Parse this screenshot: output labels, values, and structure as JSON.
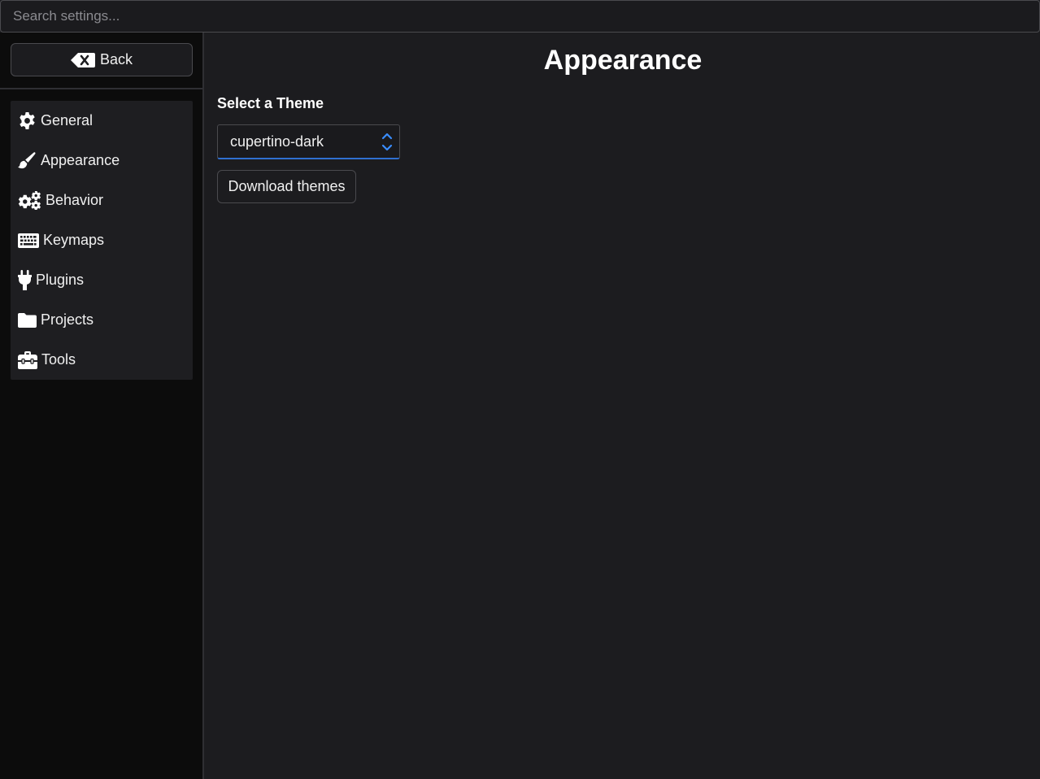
{
  "search": {
    "placeholder": "Search settings..."
  },
  "sidebar": {
    "back_label": "Back",
    "items": [
      {
        "label": "General",
        "icon": "gear-icon"
      },
      {
        "label": "Appearance",
        "icon": "paintbrush-icon"
      },
      {
        "label": "Behavior",
        "icon": "gears-icon"
      },
      {
        "label": "Keymaps",
        "icon": "keyboard-icon"
      },
      {
        "label": "Plugins",
        "icon": "plug-icon"
      },
      {
        "label": "Projects",
        "icon": "folder-icon"
      },
      {
        "label": "Tools",
        "icon": "toolbox-icon"
      }
    ]
  },
  "main": {
    "title": "Appearance",
    "theme_label": "Select a Theme",
    "theme_value": "cupertino-dark",
    "download_label": "Download themes"
  },
  "colors": {
    "background": "#1c1c1f",
    "sidebar": "#0c0c0c",
    "accent": "#2f6fd0"
  }
}
